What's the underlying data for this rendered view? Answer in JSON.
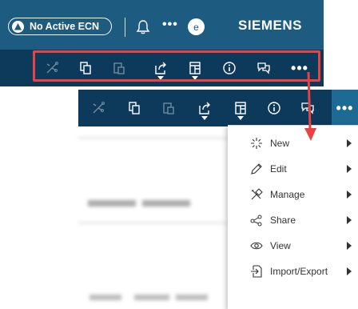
{
  "header": {
    "ecn_label": "No Active ECN",
    "avatar_initial": "e",
    "brand": "SIEMENS",
    "more_glyph": "•••",
    "icons": [
      "ecn-icon",
      "bell-icon",
      "more-icon",
      "avatar"
    ]
  },
  "toolbar": {
    "buttons": [
      {
        "name": "structure-icon",
        "disabled": true
      },
      {
        "name": "copy-icon",
        "disabled": false
      },
      {
        "name": "paste-icon",
        "disabled": true
      },
      {
        "name": "share-icon",
        "disabled": false,
        "has_dropdown": true
      },
      {
        "name": "view-layout-icon",
        "disabled": false,
        "has_dropdown": true
      },
      {
        "name": "info-icon",
        "disabled": false
      },
      {
        "name": "comments-icon",
        "disabled": false
      },
      {
        "name": "more-icon",
        "disabled": false
      }
    ],
    "more_glyph": "•••"
  },
  "menu": {
    "items": [
      {
        "label": "New",
        "icon": "new-sparkle-icon"
      },
      {
        "label": "Edit",
        "icon": "pencil-icon"
      },
      {
        "label": "Manage",
        "icon": "tools-icon"
      },
      {
        "label": "Share",
        "icon": "share-nodes-icon"
      },
      {
        "label": "View",
        "icon": "eye-icon"
      },
      {
        "label": "Import/Export",
        "icon": "import-export-icon"
      }
    ]
  },
  "colors": {
    "header_blue": "#1d5b80",
    "toolbar_navy": "#0d3a5a",
    "more_active": "#1d6a94",
    "highlight_red": "#e84242"
  }
}
